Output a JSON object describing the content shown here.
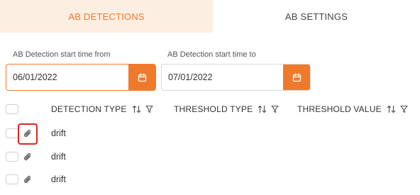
{
  "tabs": [
    {
      "label": "AB DETECTIONS",
      "active": true
    },
    {
      "label": "AB SETTINGS",
      "active": false
    }
  ],
  "filters": {
    "start_from": {
      "label": "AB Detection start time from",
      "value": "06/01/2022",
      "icon": "calendar-icon"
    },
    "start_to": {
      "label": "AB Detection start time to",
      "value": "07/01/2022",
      "icon": "calendar-icon"
    }
  },
  "table": {
    "columns": [
      {
        "label": "DETECTION TYPE",
        "sort_icon": "sort-icon",
        "filter_icon": "filter-icon"
      },
      {
        "label": "THRESHOLD TYPE",
        "sort_icon": "sort-icon",
        "filter_icon": "filter-icon"
      },
      {
        "label": "THRESHOLD VALUE",
        "sort_icon": "sort-icon",
        "filter_icon": "filter-icon"
      }
    ],
    "rows": [
      {
        "detection_type": "drift",
        "icon": "paperclip-icon",
        "highlighted": true
      },
      {
        "detection_type": "drift",
        "icon": "paperclip-icon",
        "highlighted": false
      },
      {
        "detection_type": "drift",
        "icon": "paperclip-icon",
        "highlighted": false
      }
    ]
  },
  "colors": {
    "accent": "#f07a2c",
    "active_tab_bg": "#fdeee2",
    "highlight": "#e0251f"
  }
}
